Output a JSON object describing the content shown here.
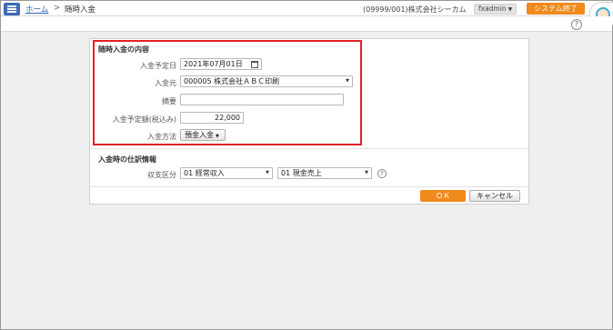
{
  "header": {
    "home_link": "ホーム",
    "separator": ">",
    "current_page": "随時入金",
    "company": "(09999/001)株式会社シーカム",
    "user": "fxadmin",
    "exit_label": "システム終了"
  },
  "help_symbol": "?",
  "section_payment": {
    "title": "随時入金の内容",
    "date_label": "入金予定日",
    "date_value": "2021年07月01日",
    "payer_label": "入金元",
    "payer_value": "000005 株式会社ＡＢＣ印刷",
    "memo_label": "摘要",
    "memo_value": "",
    "amount_label": "入金予定額(税込み)",
    "amount_value": "22,000",
    "method_label": "入金方法",
    "method_value": "預金入金"
  },
  "section_journal": {
    "title": "入金時の仕訳情報",
    "category_label": "収支区分",
    "category_value1": "01 経常収入",
    "category_value2": "01 現金売上"
  },
  "actions": {
    "ok_label": "ＯＫ",
    "cancel_label": "キャンセル"
  },
  "colors": {
    "accent": "#f08a1c",
    "menu": "#3a6cb8",
    "highlight": "#e0212a",
    "link": "#2a62c0"
  }
}
